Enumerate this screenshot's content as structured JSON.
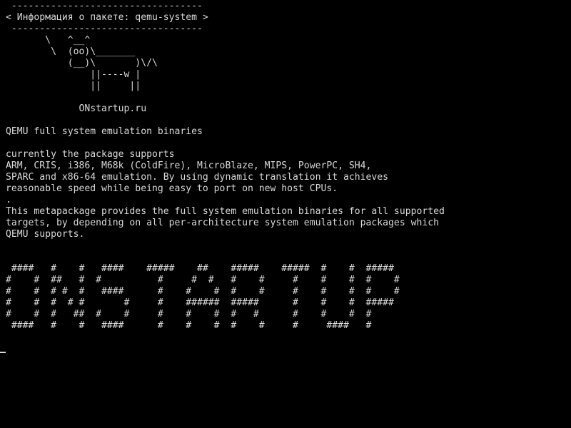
{
  "terminal": {
    "lines": [
      " ----------------------------------",
      "< Информация о пакете: qemu-system >",
      " ----------------------------------",
      "       \\   ^__^",
      "        \\  (oo)\\_______",
      "           (__)\\       )\\/\\",
      "               ||----w |",
      "               ||     ||",
      "",
      "             ONstartup.ru",
      "",
      "QEMU full system emulation binaries",
      "",
      "currently the package supports",
      "ARM, CRIS, i386, M68k (ColdFire), MicroBlaze, MIPS, PowerPC, SH4,",
      "SPARC and x86-64 emulation. By using dynamic translation it achieves",
      "reasonable speed while being easy to port on new host CPUs.",
      ".",
      "This metapackage provides the full system emulation binaries for all supported",
      "targets, by depending on all per-architecture system emulation packages which",
      "QEMU supports.",
      "",
      "",
      " ####   #    #   ####    #####    ##    #####    #####  #    #  #####",
      "#    #  ##   #  #          #     #  #   #    #     #    #    #  #    #",
      "#    #  # #  #   ####      #    #    #  #    #     #    #    #  #    #",
      "#    #  #  # #       #     #    ######  #####      #    #    #  #####",
      "#    #  #   ##  #    #     #    #    #  #   #      #    #    #  #",
      " ####   #    #   ####      #    #    #  #    #     #     ####   #"
    ]
  }
}
